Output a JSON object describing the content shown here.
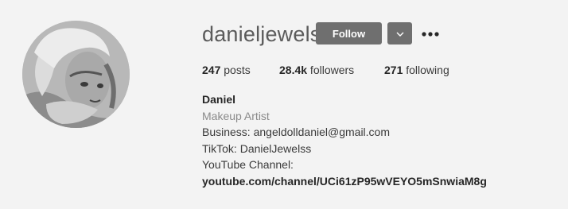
{
  "profile": {
    "username": "danieljewels",
    "follow_label": "Follow",
    "dropdown_icon": "chevron-down-icon",
    "more_icon": "more-options-icon"
  },
  "stats": {
    "posts_count": "247",
    "posts_label": " posts",
    "followers_count": "28.4k",
    "followers_label": " followers",
    "following_count": "271",
    "following_label": " following"
  },
  "bio": {
    "name": "Daniel",
    "category": "Makeup Artist",
    "line1": "Business: angeldolldaniel@gmail.com",
    "line2": "TikTok: DanielJewelss",
    "line3": "YouTube Channel:",
    "link": "youtube.com/channel/UCi61zP95wVEYO5mSnwiaM8g"
  },
  "colors": {
    "background": "#f3f3f3",
    "button": "#6f6f6f",
    "category_text": "#8a8a8a"
  }
}
